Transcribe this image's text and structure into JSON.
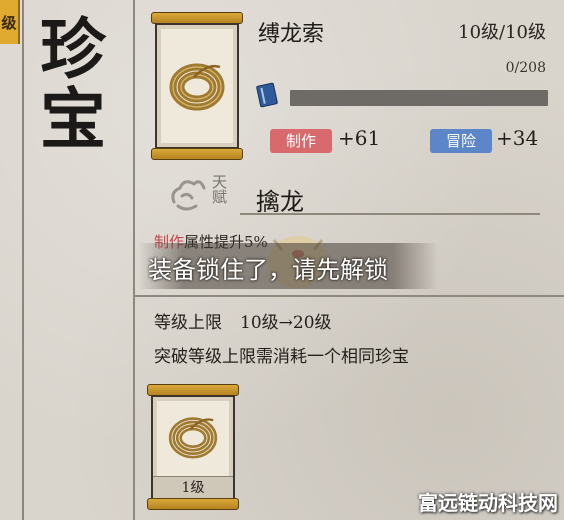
{
  "side_tab": {
    "label": "级"
  },
  "page_title": "珍宝",
  "item": {
    "name": "缚龙索",
    "level": "10级/10级",
    "exp": "0/208",
    "exp_progress": 0,
    "stats": [
      {
        "label": "制作",
        "value": "+61",
        "color": "#d86a6e"
      },
      {
        "label": "冒险",
        "value": "+34",
        "color": "#5c86c8"
      }
    ]
  },
  "talent": {
    "label": "天赋",
    "name": "擒龙",
    "desc_highlight": "制作",
    "desc_rest": "属性提升5%"
  },
  "toast": {
    "text": "装备锁住了，请先解锁"
  },
  "breakthrough": {
    "cap_label": "等级上限",
    "cap_from": "10级",
    "arrow": "→",
    "cap_to": "20级",
    "requirement": "突破等级上限需消耗一个相同珍宝"
  },
  "material": {
    "level": "1级"
  },
  "watermark": "富远链动科技网",
  "icons": [
    "book-icon",
    "rope-coil-icon",
    "talent-cloud-icon",
    "arrow-right-icon"
  ]
}
